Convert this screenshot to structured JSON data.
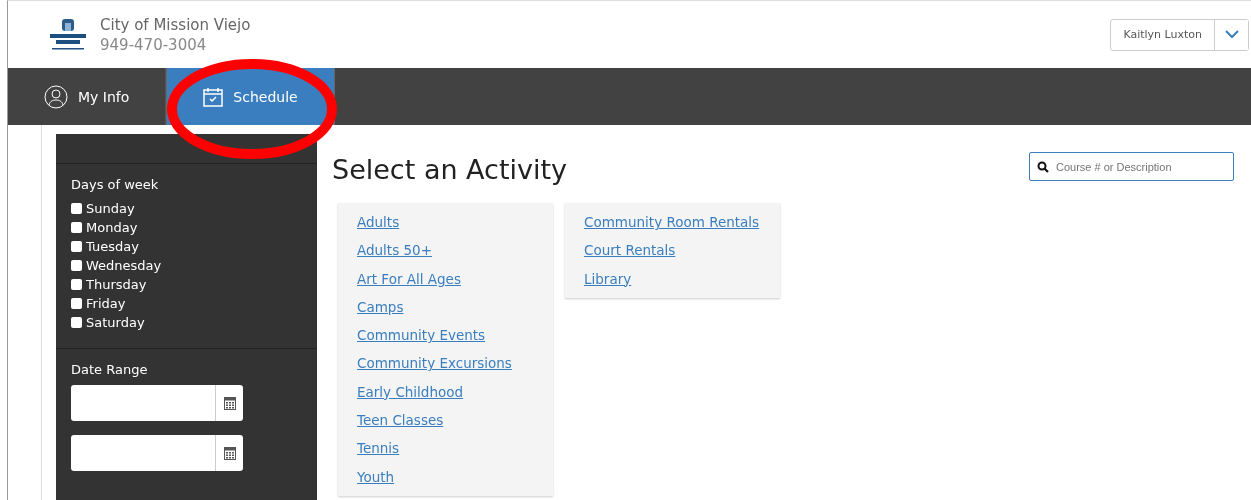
{
  "header": {
    "org_name": "City of Mission Viejo",
    "phone": "949-470-3004",
    "user": "Kaitlyn Luxton"
  },
  "tabs": [
    {
      "label": "My Info",
      "kind": "person",
      "selected": false
    },
    {
      "label": "Schedule",
      "kind": "calendar",
      "selected": true
    }
  ],
  "annotation": {
    "kind": "ellipse"
  },
  "filters": {
    "days_title": "Days of week",
    "days": [
      {
        "label": "Sunday",
        "checked": false
      },
      {
        "label": "Monday",
        "checked": false
      },
      {
        "label": "Tuesday",
        "checked": false
      },
      {
        "label": "Wednesday",
        "checked": false
      },
      {
        "label": "Thursday",
        "checked": false
      },
      {
        "label": "Friday",
        "checked": false
      },
      {
        "label": "Saturday",
        "checked": false
      }
    ],
    "date_title": "Date Range"
  },
  "main": {
    "title": "Select an Activity",
    "search_placeholder": "Course # or Description",
    "columns": [
      [
        "Adults",
        "Adults 50+",
        "Art For All Ages",
        "Camps",
        "Community Events",
        "Community Excursions",
        "Early Childhood",
        "Teen Classes",
        "Tennis",
        "Youth"
      ],
      [
        "Community Room Rentals",
        "Court Rentals",
        "Library"
      ]
    ]
  }
}
